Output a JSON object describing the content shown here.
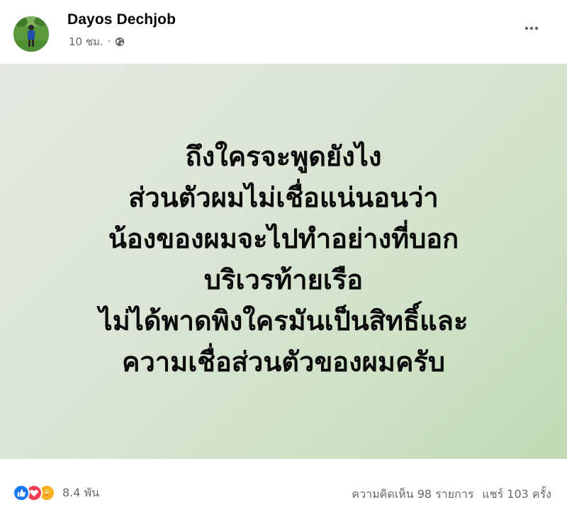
{
  "post": {
    "author": "Dayos Dechjob",
    "timestamp": "10 ชม.",
    "separator": "·",
    "privacy_icon": "globe-icon",
    "more_icon": "ellipsis-icon",
    "background_colors": [
      "#e5e8e3",
      "#bfdab3"
    ],
    "lines": [
      "ถึงใครจะพูดยังไง",
      "ส่วนตัวผมไม่เชื่อแน่นอนว่า",
      "น้องของผมจะไปทำอย่างที่บอก",
      "บริเวรท้ายเรือ",
      "ไม่ได้พาดพิงใครมันเป็นสิทธิ์และ",
      "ความเชื่อส่วนตัวของผมครับ"
    ]
  },
  "footer": {
    "reaction_icons": [
      "like-icon",
      "love-icon",
      "care-icon"
    ],
    "reaction_colors": [
      "#1877f2",
      "#f33e58",
      "#f7b125"
    ],
    "reaction_count": "8.4 พัน",
    "comments": "ความคิดเห็น 98 รายการ",
    "shares": "แชร์ 103 ครั้ง"
  }
}
